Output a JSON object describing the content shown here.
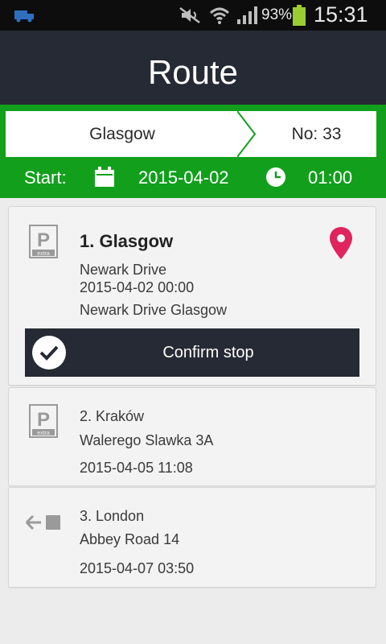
{
  "status_bar": {
    "battery_percent": "93%",
    "time": "15:31",
    "icons": [
      "truck-icon",
      "mute-icon",
      "wifi-icon",
      "signal-icon",
      "battery-icon"
    ]
  },
  "header": {
    "title": "Route"
  },
  "route_bar": {
    "from": "Glasgow",
    "number": "No: 33",
    "start_label": "Start:",
    "start_date": "2015-04-02",
    "start_time": "01:00"
  },
  "colors": {
    "accent_green": "#12a01c",
    "dark_bar": "#262a34",
    "pin_red": "#e0245e"
  },
  "stops": [
    {
      "title": "1. Glasgow",
      "street": "Newark Drive",
      "datetime": "2015-04-02 00:00",
      "address": "Newark Drive Glasgow",
      "icon": "parking-extra-icon",
      "confirm_label": "Confirm stop"
    },
    {
      "title": "2. Kraków",
      "street": "Walerego Slawka 3A",
      "datetime": "2015-04-05 11:08",
      "icon": "parking-extra-icon"
    },
    {
      "title": "3. London",
      "street": "Abbey Road 14",
      "datetime": "2015-04-07 03:50",
      "icon": "arrow-left-icon"
    }
  ],
  "parking_icon_text": {
    "letter": "P",
    "caption": "extra"
  }
}
